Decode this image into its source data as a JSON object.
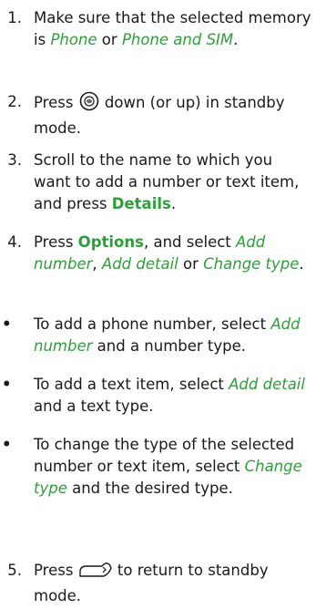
{
  "steps": [
    {
      "number": "1.",
      "parts": [
        {
          "text": "Make sure that the selected memory is ",
          "style": "plain"
        },
        {
          "text": "Phone",
          "style": "em"
        },
        {
          "text": " or ",
          "style": "plain"
        },
        {
          "text": "Phone and SIM",
          "style": "em"
        },
        {
          "text": ".",
          "style": "plain"
        }
      ]
    },
    {
      "number": "2.",
      "parts": [
        {
          "text": "Press ",
          "style": "plain"
        },
        {
          "icon": "scroll-key-icon"
        },
        {
          "text": " down (or up) in standby mode.",
          "style": "plain"
        }
      ]
    },
    {
      "number": "3.",
      "parts": [
        {
          "text": "Scroll to the name to which you want to add a number or text item, and press ",
          "style": "plain"
        },
        {
          "text": "Details",
          "style": "strong"
        },
        {
          "text": ".",
          "style": "plain"
        }
      ]
    },
    {
      "number": "4.",
      "parts": [
        {
          "text": "Press ",
          "style": "plain"
        },
        {
          "text": "Options",
          "style": "strong"
        },
        {
          "text": ", and select ",
          "style": "plain"
        },
        {
          "text": "Add number",
          "style": "em"
        },
        {
          "text": ", ",
          "style": "plain"
        },
        {
          "text": "Add detail",
          "style": "em"
        },
        {
          "text": " or ",
          "style": "plain"
        },
        {
          "text": "Change type",
          "style": "em"
        },
        {
          "text": ".",
          "style": "plain"
        }
      ]
    }
  ],
  "bullets": [
    {
      "marker": "•",
      "parts": [
        {
          "text": "To add a phone number, select ",
          "style": "plain"
        },
        {
          "text": "Add number",
          "style": "em"
        },
        {
          "text": " and a number type.",
          "style": "plain"
        }
      ]
    },
    {
      "marker": "•",
      "parts": [
        {
          "text": "To add a text item, select ",
          "style": "plain"
        },
        {
          "text": "Add detail",
          "style": "em"
        },
        {
          "text": " and a text type.",
          "style": "plain"
        }
      ]
    },
    {
      "marker": "•",
      "parts": [
        {
          "text": "To change the type of the selected number or text item, select ",
          "style": "plain"
        },
        {
          "text": "Change type",
          "style": "em"
        },
        {
          "text": " and the desired type.",
          "style": "plain"
        }
      ]
    }
  ],
  "final_step": {
    "number": "5.",
    "parts": [
      {
        "text": "Press ",
        "style": "plain"
      },
      {
        "icon": "end-key-icon"
      },
      {
        "text": " to return to standby mode.",
        "style": "plain"
      }
    ]
  },
  "colors": {
    "accent": "#2f9e3a",
    "text": "#1a1a1a"
  }
}
